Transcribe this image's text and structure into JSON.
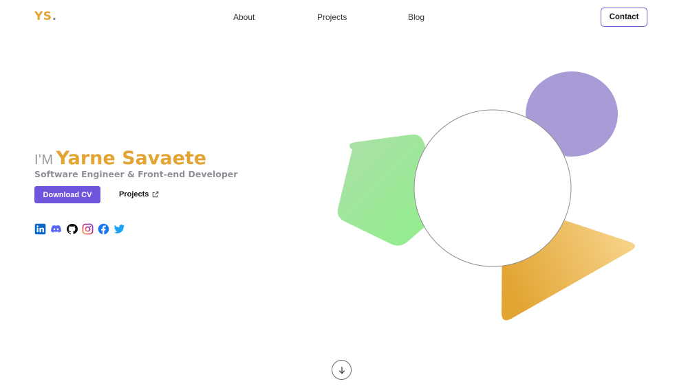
{
  "brand": {
    "logo_text": "YS",
    "logo_dot": ".",
    "color": "#e2a432"
  },
  "nav": {
    "about": "About",
    "projects": "Projects",
    "blog": "Blog",
    "contact": "Contact"
  },
  "hero": {
    "prefix": "I'M",
    "name": "Yarne Savaete",
    "subtitle": "Software Engineer & Front-end Developer",
    "download_cv": "Download CV",
    "projects_link": "Projects"
  },
  "socials": [
    {
      "icon": "linkedin-icon",
      "color": "#0a66c2"
    },
    {
      "icon": "discord-icon",
      "color": "#5865f2"
    },
    {
      "icon": "github-icon",
      "color": "#111111"
    },
    {
      "icon": "instagram-icon",
      "color": "#d62976"
    },
    {
      "icon": "facebook-icon",
      "color": "#1877f2"
    },
    {
      "icon": "twitter-icon",
      "color": "#1da1f2"
    }
  ],
  "colors": {
    "accent": "#e2a432",
    "primary_button": "#6e55dc",
    "contact_border": "#6f5cd8",
    "shape_purple": "#a99bd6",
    "shape_green": "#9ee89a",
    "shape_gold": "#e8b44a"
  },
  "scroll_icon": "arrow-down-icon"
}
